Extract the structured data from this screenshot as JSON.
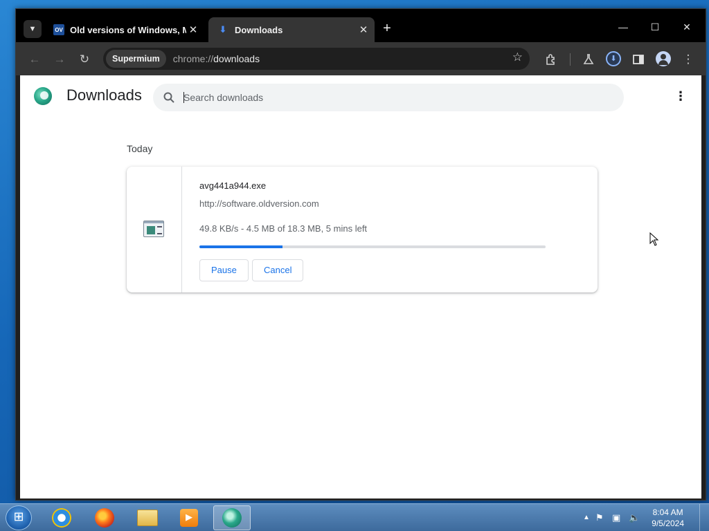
{
  "browser": {
    "tabs": [
      {
        "favicon": "OV",
        "title": "Old versions of Windows, Mac",
        "close": "✕"
      },
      {
        "title": "Downloads",
        "close": "✕"
      }
    ],
    "new_tab": "+",
    "window_controls": {
      "minimize": "—",
      "maximize": "☐",
      "close": "✕"
    },
    "omnibox": {
      "chip": "Supermium",
      "scheme": "chrome://",
      "path": "downloads"
    }
  },
  "page": {
    "title": "Downloads",
    "search_placeholder": "Search downloads",
    "menu": "⋮",
    "section_label": "Today",
    "download": {
      "file_name": "avg441a944.exe",
      "source_url": "http://software.oldversion.com",
      "status": "49.8 KB/s - 4.5 MB of 18.3 MB, 5 mins left",
      "progress": 0.24,
      "pause_label": "Pause",
      "cancel_label": "Cancel"
    }
  },
  "taskbar": {
    "clock_time": "8:04 AM",
    "clock_date": "9/5/2024"
  },
  "colors": {
    "accent": "#1a73e8",
    "titlebar": "#000000",
    "toolbar": "#353535"
  }
}
